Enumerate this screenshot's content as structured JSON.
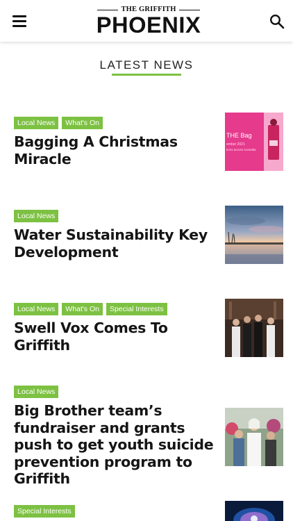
{
  "header": {
    "logo_top": "THE GRIFFITH",
    "logo_main": "PHOENIX",
    "menu_icon": "hamburger-menu-icon",
    "search_icon": "search-icon"
  },
  "section": {
    "title": "LATEST NEWS",
    "accent_color": "#7dc142"
  },
  "articles": [
    {
      "tags": [
        "Local News",
        "What's On"
      ],
      "headline": "Bagging A Christmas Miracle",
      "thumb_text": "THE Bag",
      "thumb_subtext_1": "ember 2021",
      "thumb_subtext_2": "tions across Australia"
    },
    {
      "tags": [
        "Local News"
      ],
      "headline": "Water Sustainability Key Development"
    },
    {
      "tags": [
        "Local News",
        "What's On",
        "Special Interests"
      ],
      "headline": "Swell Vox Comes To Griffith"
    },
    {
      "tags": [
        "Local News"
      ],
      "headline": "Big Brother team’s fundraiser and grants push to get youth suicide prevention program to Griffith"
    },
    {
      "tags": [
        "Special Interests"
      ],
      "headline": ""
    }
  ]
}
